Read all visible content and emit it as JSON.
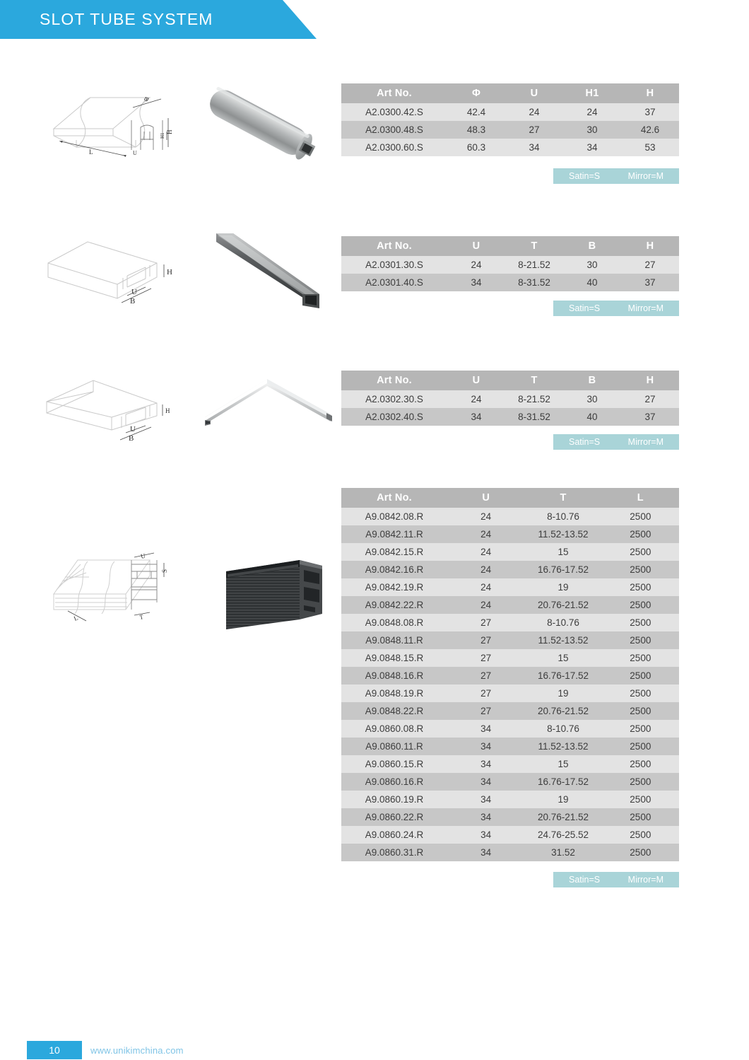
{
  "page": {
    "title": "SLOT TUBE SYSTEM",
    "number": "10",
    "website": "www.unikimchina.com",
    "accent_blue": "#2ba8dd",
    "table_header_gray": "#b6b6b6",
    "row_light": "#e3e3e3",
    "row_dark": "#c7c7c7",
    "finish_badge_color": "#a9d4d8"
  },
  "finish_note": {
    "satin": "Satin=S",
    "mirror": "Mirror=M"
  },
  "sections": [
    {
      "id": "round-slot-tube",
      "drawing_labels": [
        "L",
        "Φ",
        "H",
        "H1",
        "U"
      ],
      "columns": [
        "Art No.",
        "Φ",
        "U",
        "H1",
        "H"
      ],
      "rows": [
        [
          "A2.0300.42.S",
          "42.4",
          "24",
          "24",
          "37"
        ],
        [
          "A2.0300.48.S",
          "48.3",
          "27",
          "30",
          "42.6"
        ],
        [
          "A2.0300.60.S",
          "60.3",
          "34",
          "34",
          "53"
        ]
      ]
    },
    {
      "id": "square-slot-tube",
      "drawing_labels": [
        "H",
        "U",
        "B"
      ],
      "columns": [
        "Art No.",
        "U",
        "T",
        "B",
        "H"
      ],
      "rows": [
        [
          "A2.0301.30.S",
          "24",
          "8-21.52",
          "30",
          "27"
        ],
        [
          "A2.0301.40.S",
          "34",
          "8-31.52",
          "40",
          "37"
        ]
      ]
    },
    {
      "id": "square-slot-tube-corner",
      "drawing_labels": [
        "H",
        "U",
        "B"
      ],
      "columns": [
        "Art No.",
        "U",
        "T",
        "B",
        "H"
      ],
      "rows": [
        [
          "A2.0302.30.S",
          "24",
          "8-21.52",
          "30",
          "27"
        ],
        [
          "A2.0302.40.S",
          "34",
          "8-31.52",
          "40",
          "37"
        ]
      ]
    },
    {
      "id": "rubber-gasket-profile",
      "drawing_labels": [
        "L",
        "U",
        "T"
      ],
      "columns": [
        "Art No.",
        "U",
        "T",
        "L"
      ],
      "rows": [
        [
          "A9.0842.08.R",
          "24",
          "8-10.76",
          "2500"
        ],
        [
          "A9.0842.11.R",
          "24",
          "11.52-13.52",
          "2500"
        ],
        [
          "A9.0842.15.R",
          "24",
          "15",
          "2500"
        ],
        [
          "A9.0842.16.R",
          "24",
          "16.76-17.52",
          "2500"
        ],
        [
          "A9.0842.19.R",
          "24",
          "19",
          "2500"
        ],
        [
          "A9.0842.22.R",
          "24",
          "20.76-21.52",
          "2500"
        ],
        [
          "A9.0848.08.R",
          "27",
          "8-10.76",
          "2500"
        ],
        [
          "A9.0848.11.R",
          "27",
          "11.52-13.52",
          "2500"
        ],
        [
          "A9.0848.15.R",
          "27",
          "15",
          "2500"
        ],
        [
          "A9.0848.16.R",
          "27",
          "16.76-17.52",
          "2500"
        ],
        [
          "A9.0848.19.R",
          "27",
          "19",
          "2500"
        ],
        [
          "A9.0848.22.R",
          "27",
          "20.76-21.52",
          "2500"
        ],
        [
          "A9.0860.08.R",
          "34",
          "8-10.76",
          "2500"
        ],
        [
          "A9.0860.11.R",
          "34",
          "11.52-13.52",
          "2500"
        ],
        [
          "A9.0860.15.R",
          "34",
          "15",
          "2500"
        ],
        [
          "A9.0860.16.R",
          "34",
          "16.76-17.52",
          "2500"
        ],
        [
          "A9.0860.19.R",
          "34",
          "19",
          "2500"
        ],
        [
          "A9.0860.22.R",
          "34",
          "20.76-21.52",
          "2500"
        ],
        [
          "A9.0860.24.R",
          "34",
          "24.76-25.52",
          "2500"
        ],
        [
          "A9.0860.31.R",
          "34",
          "31.52",
          "2500"
        ]
      ]
    }
  ]
}
